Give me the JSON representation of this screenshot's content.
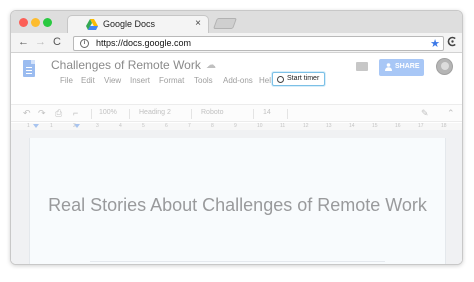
{
  "browser": {
    "tab_title": "Google Docs",
    "tab_close": "×",
    "url": "https://docs.google.com",
    "accent": "#3b78e7"
  },
  "nav": {
    "back": "←",
    "forward": "→",
    "reload": "C",
    "menu": "⋮"
  },
  "docs": {
    "title": "Challenges of Remote Work",
    "menu": [
      "File",
      "Edit",
      "View",
      "Insert",
      "Format",
      "Tools",
      "Add-ons",
      "Help"
    ],
    "start_timer_label": "Start timer",
    "share_label": "SHARE",
    "share_color": "#a8c7f6"
  },
  "format_toolbar": {
    "zoom": "100%",
    "style": "Heading 2",
    "font": "Roboto",
    "size": "14"
  },
  "ruler": {
    "numbers": [
      "1",
      "1",
      "2",
      "3",
      "4",
      "5",
      "6",
      "7",
      "8",
      "9",
      "10",
      "11",
      "12",
      "13",
      "14",
      "15",
      "16",
      "17",
      "18"
    ]
  },
  "document": {
    "heading": "Real Stories About Challenges of Remote Work"
  },
  "icons": {
    "back": "arrow-left-icon",
    "forward": "arrow-right-icon",
    "reload": "reload-icon",
    "info": "info-icon",
    "star": "star-icon",
    "timer": "clockify-icon"
  }
}
